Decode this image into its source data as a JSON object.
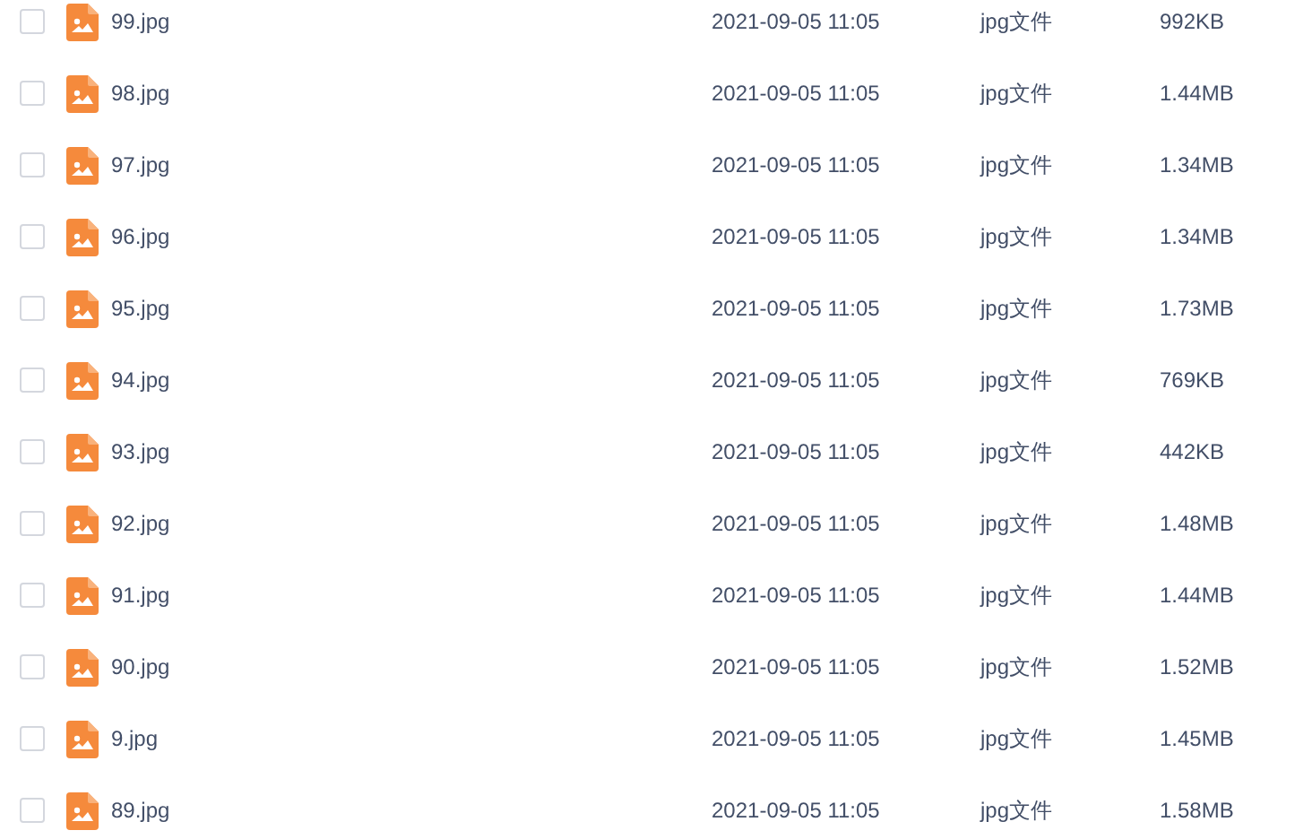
{
  "files": [
    {
      "name": "99.jpg",
      "modified": "2021-09-05 11:05",
      "type": "jpg文件",
      "size": "992KB",
      "checked": false
    },
    {
      "name": "98.jpg",
      "modified": "2021-09-05 11:05",
      "type": "jpg文件",
      "size": "1.44MB",
      "checked": false
    },
    {
      "name": "97.jpg",
      "modified": "2021-09-05 11:05",
      "type": "jpg文件",
      "size": "1.34MB",
      "checked": false
    },
    {
      "name": "96.jpg",
      "modified": "2021-09-05 11:05",
      "type": "jpg文件",
      "size": "1.34MB",
      "checked": false
    },
    {
      "name": "95.jpg",
      "modified": "2021-09-05 11:05",
      "type": "jpg文件",
      "size": "1.73MB",
      "checked": false
    },
    {
      "name": "94.jpg",
      "modified": "2021-09-05 11:05",
      "type": "jpg文件",
      "size": "769KB",
      "checked": false
    },
    {
      "name": "93.jpg",
      "modified": "2021-09-05 11:05",
      "type": "jpg文件",
      "size": "442KB",
      "checked": false
    },
    {
      "name": "92.jpg",
      "modified": "2021-09-05 11:05",
      "type": "jpg文件",
      "size": "1.48MB",
      "checked": false
    },
    {
      "name": "91.jpg",
      "modified": "2021-09-05 11:05",
      "type": "jpg文件",
      "size": "1.44MB",
      "checked": false
    },
    {
      "name": "90.jpg",
      "modified": "2021-09-05 11:05",
      "type": "jpg文件",
      "size": "1.52MB",
      "checked": false
    },
    {
      "name": "9.jpg",
      "modified": "2021-09-05 11:05",
      "type": "jpg文件",
      "size": "1.45MB",
      "checked": false
    },
    {
      "name": "89.jpg",
      "modified": "2021-09-05 11:05",
      "type": "jpg文件",
      "size": "1.58MB",
      "checked": false
    }
  ]
}
